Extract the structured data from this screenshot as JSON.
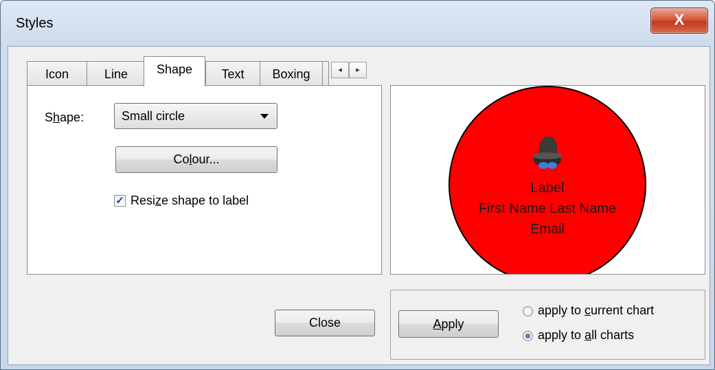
{
  "window": {
    "title": "Styles",
    "close_glyph": "X"
  },
  "tabs": [
    {
      "label": "Icon",
      "active": false
    },
    {
      "label": "Line",
      "active": false
    },
    {
      "label": "Shape",
      "active": true
    },
    {
      "label": "Text",
      "active": false
    },
    {
      "label": "Boxing",
      "active": false
    }
  ],
  "tab_scroll": {
    "left": "◂",
    "right": "▸"
  },
  "shape_panel": {
    "shape_label_pre": "S",
    "shape_label_mnemonic": "h",
    "shape_label_post": "ape:",
    "shape_value": "Small circle",
    "colour_pre": "Co",
    "colour_mnemonic": "l",
    "colour_post": "our...",
    "resize_pre": "Resi",
    "resize_mnemonic": "z",
    "resize_post": "e shape to label",
    "resize_checked": true
  },
  "preview": {
    "fill_color": "#ff0000",
    "icon": "spy-hat-glasses-icon",
    "lines": [
      "Label",
      "First Name Last Name",
      "Email"
    ]
  },
  "buttons": {
    "close": "Close",
    "apply_mnemonic": "A",
    "apply_rest": "pply"
  },
  "apply_scope": {
    "current_pre": "apply to ",
    "current_mnemonic": "c",
    "current_post": "urrent chart",
    "all_pre": "apply to ",
    "all_mnemonic": "a",
    "all_post": "ll charts",
    "selected": "all"
  }
}
